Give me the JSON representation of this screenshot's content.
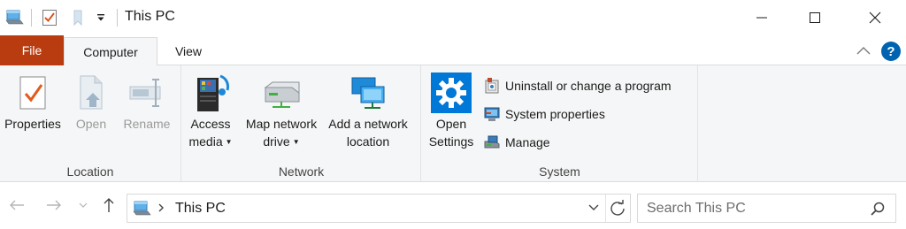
{
  "window": {
    "title": "This PC",
    "minimize_glyph": "—",
    "maximize_glyph": "☐",
    "close_glyph": "✕"
  },
  "quick_access": {
    "icons": [
      "this-pc-icon",
      "properties-check-icon",
      "new-folder-icon",
      "customize-dropdown-icon"
    ]
  },
  "ribbon": {
    "tabs": [
      {
        "label": "File",
        "state": "file"
      },
      {
        "label": "Computer",
        "state": "active"
      },
      {
        "label": "View",
        "state": "normal"
      }
    ],
    "help_label": "?",
    "colors": {
      "file_tab": "#b83c0f",
      "accent": "#0063b1",
      "ribbon_bg": "#f5f6f7"
    },
    "groups": {
      "location": {
        "label": "Location",
        "buttons": {
          "properties": "Properties",
          "open": "Open",
          "rename": "Rename"
        }
      },
      "network": {
        "label": "Network",
        "buttons": {
          "access_media_1": "Access",
          "access_media_2": "media",
          "map_drive_1": "Map network",
          "map_drive_2": "drive",
          "add_location_1": "Add a network",
          "add_location_2": "location"
        }
      },
      "system": {
        "label": "System",
        "buttons": {
          "open_settings_1": "Open",
          "open_settings_2": "Settings",
          "uninstall": "Uninstall or change a program",
          "system_properties": "System properties",
          "manage": "Manage"
        }
      }
    }
  },
  "navigation": {
    "address_path": "This PC",
    "search_placeholder": "Search This PC"
  }
}
